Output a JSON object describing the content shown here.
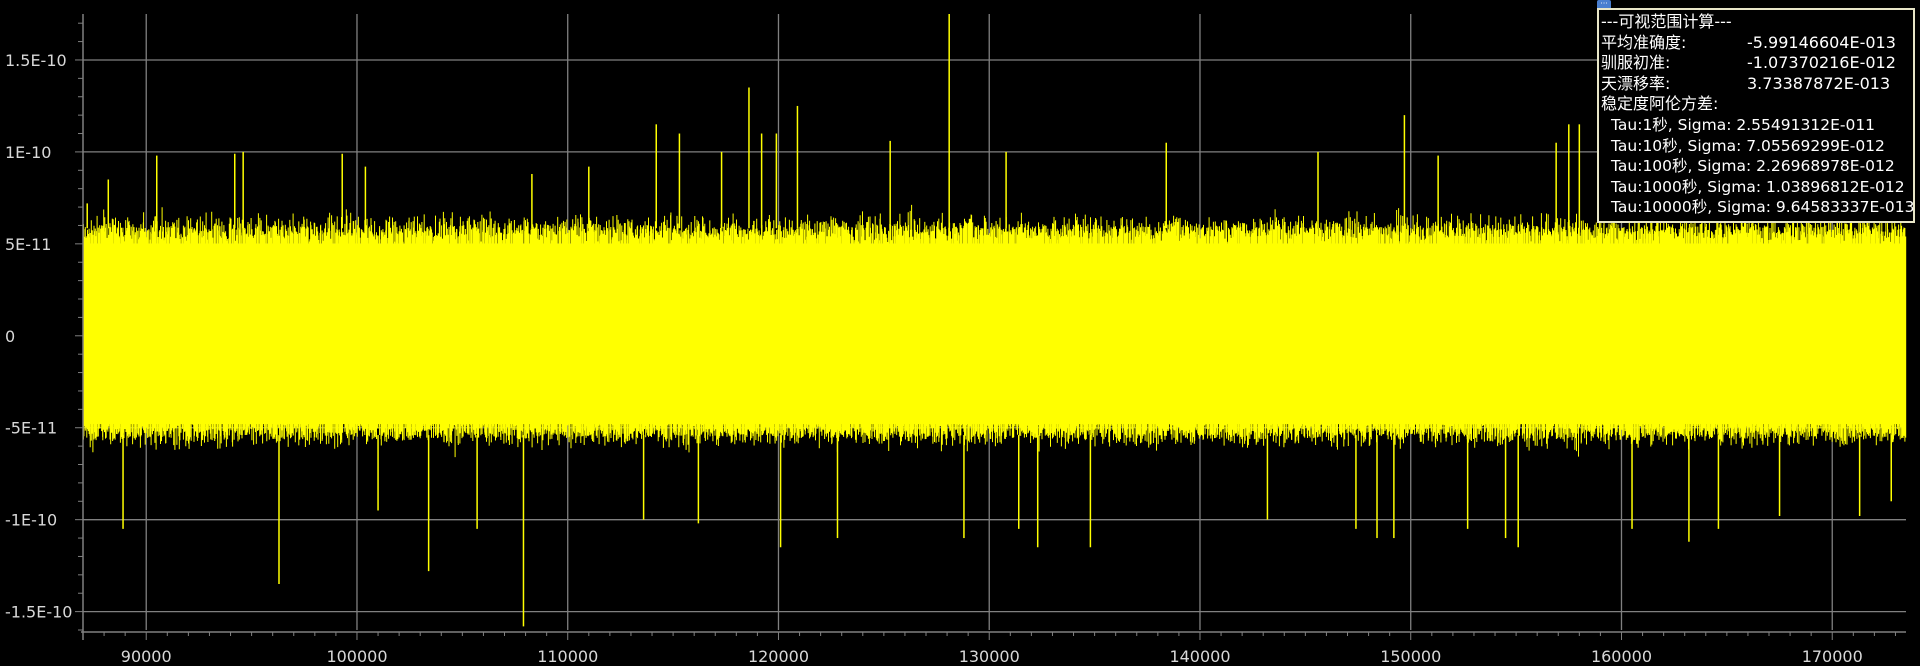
{
  "colors": {
    "background": "#000000",
    "trace": "#ffff00",
    "grid": "#808080",
    "axis_text": "#d8d8d8",
    "panel_border": "#e8e6c8",
    "panel_text": "#ffffff",
    "handle": "#4a7fd0"
  },
  "panel": {
    "handle_icon": "collapse-icon",
    "title": "---可视范围计算---",
    "rows": [
      {
        "label": "平均准确度:",
        "value": "-5.99146604E-013"
      },
      {
        "label": "驯服初准:",
        "value": "-1.07370216E-012"
      },
      {
        "label": "天漂移率:",
        "value": "3.73387872E-013"
      }
    ],
    "allan_title": "稳定度阿伦方差:",
    "allan": [
      "Tau:1秒, Sigma: 2.55491312E-011",
      "Tau:10秒, Sigma: 7.05569299E-012",
      "Tau:100秒, Sigma: 2.26968978E-012",
      "Tau:1000秒, Sigma: 1.03896812E-012",
      "Tau:10000秒, Sigma: 9.64583337E-013"
    ]
  },
  "chart_data": {
    "type": "line",
    "title": "",
    "xlabel": "",
    "ylabel": "",
    "xlim": [
      87000,
      173500
    ],
    "ylim": [
      -1.6e-10,
      1.75e-10
    ],
    "grid": true,
    "x_ticks": [
      90000,
      100000,
      110000,
      120000,
      130000,
      140000,
      150000,
      160000,
      170000
    ],
    "x_tick_labels": [
      "90000",
      "100000",
      "110000",
      "120000",
      "130000",
      "140000",
      "150000",
      "160000",
      "170000"
    ],
    "y_ticks": [
      1.5e-10,
      1e-10,
      5e-11,
      0,
      -5e-11,
      -1e-10,
      -1.5e-10
    ],
    "y_tick_labels": [
      "1.5E-10",
      "1E-10",
      "5E-11",
      "0",
      "-5E-11",
      "-1E-10",
      "-1.5E-10"
    ],
    "series": [
      {
        "color": "#ffff00",
        "envelope": {
          "typical_max": 6.5e-11,
          "typical_min": -6e-11,
          "dense_band": [
            -4.8e-11,
            5e-11
          ]
        },
        "spikes": [
          [
            87200,
            7.2e-11
          ],
          [
            88200,
            8.5e-11
          ],
          [
            88900,
            -1.05e-10
          ],
          [
            90500,
            9.8e-11
          ],
          [
            94200,
            9.9e-11
          ],
          [
            94600,
            1e-10
          ],
          [
            96300,
            -1.35e-10
          ],
          [
            99300,
            9.9e-11
          ],
          [
            100400,
            9.2e-11
          ],
          [
            101000,
            -9.5e-11
          ],
          [
            103400,
            -1.28e-10
          ],
          [
            105700,
            -1.05e-10
          ],
          [
            107900,
            -1.58e-10
          ],
          [
            108300,
            8.8e-11
          ],
          [
            111000,
            9.2e-11
          ],
          [
            113600,
            -1e-10
          ],
          [
            114200,
            1.15e-10
          ],
          [
            115300,
            1.1e-10
          ],
          [
            116200,
            -1.02e-10
          ],
          [
            117300,
            1e-10
          ],
          [
            118600,
            1.35e-10
          ],
          [
            119200,
            1.1e-10
          ],
          [
            119900,
            1.1e-10
          ],
          [
            120100,
            -1.15e-10
          ],
          [
            120900,
            1.25e-10
          ],
          [
            122800,
            -1.1e-10
          ],
          [
            125300,
            1.06e-10
          ],
          [
            128100,
            1.75e-10
          ],
          [
            128800,
            -1.1e-10
          ],
          [
            130800,
            1e-10
          ],
          [
            131400,
            -1.05e-10
          ],
          [
            132300,
            -1.15e-10
          ],
          [
            134800,
            -1.15e-10
          ],
          [
            138400,
            1.05e-10
          ],
          [
            143200,
            -1e-10
          ],
          [
            145600,
            1e-10
          ],
          [
            147400,
            -1.05e-10
          ],
          [
            148400,
            -1.1e-10
          ],
          [
            149200,
            -1.1e-10
          ],
          [
            149700,
            1.2e-10
          ],
          [
            151300,
            9.8e-11
          ],
          [
            152700,
            -1.05e-10
          ],
          [
            154500,
            -1.1e-10
          ],
          [
            155100,
            -1.15e-10
          ],
          [
            156900,
            1.05e-10
          ],
          [
            157500,
            1.15e-10
          ],
          [
            158000,
            1.15e-10
          ],
          [
            159600,
            1e-10
          ],
          [
            160500,
            -1.05e-10
          ],
          [
            163200,
            -1.12e-10
          ],
          [
            164600,
            -1.05e-10
          ],
          [
            167500,
            -9.8e-11
          ],
          [
            171300,
            -9.8e-11
          ],
          [
            172800,
            -9e-11
          ]
        ]
      }
    ]
  }
}
